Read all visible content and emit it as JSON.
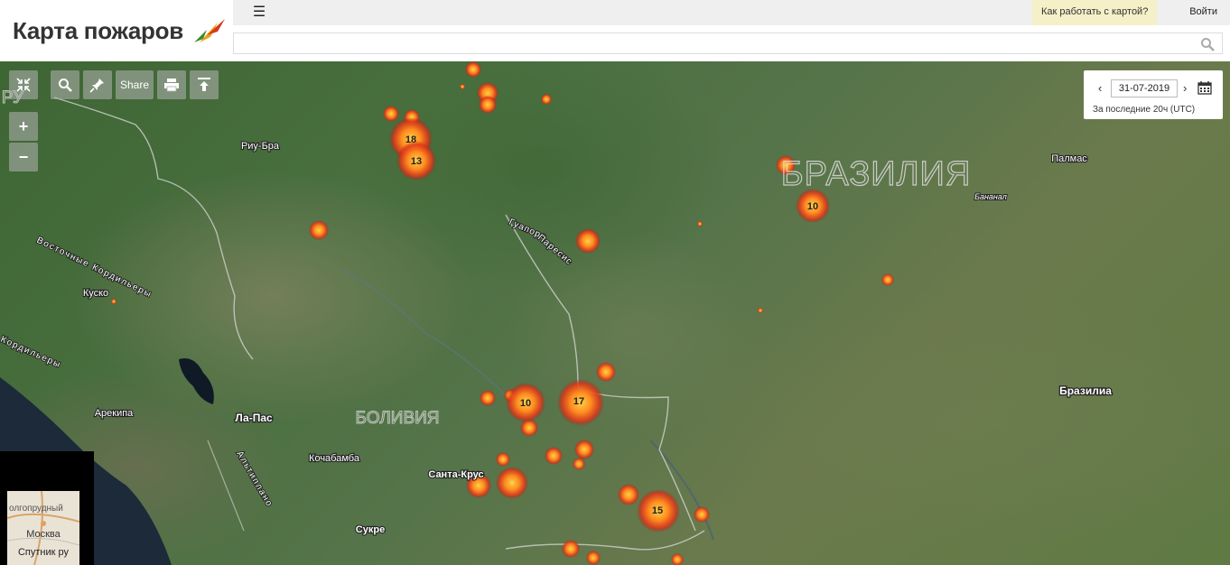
{
  "brand": {
    "title": "Карта пожаров"
  },
  "topbar": {
    "menu_icon": "☰",
    "help": "Как работать с картой?",
    "login": "Войти"
  },
  "search": {
    "value": "",
    "placeholder": ""
  },
  "controls": {
    "share_label": "Share",
    "zoom_in": "+",
    "zoom_out": "−"
  },
  "date": {
    "value": "31-07-2019",
    "period": "За последние 20ч (UTC)"
  },
  "map": {
    "places": [
      {
        "label": "Риу-Бра",
        "bold": false
      },
      {
        "label": "Палмас",
        "bold": false
      },
      {
        "label": "Бананал",
        "bold": false
      },
      {
        "label": "БРАЗИЛИЯ",
        "bold": false
      },
      {
        "label": "Куско",
        "bold": false
      },
      {
        "label": "Арекипа",
        "bold": false
      },
      {
        "label": "Ла-Пас",
        "bold": true
      },
      {
        "label": "Кочабамба",
        "bold": false
      },
      {
        "label": "Санта-Крус",
        "bold": false
      },
      {
        "label": "Сукре",
        "bold": false
      },
      {
        "label": "Бразилиа",
        "bold": true
      },
      {
        "label": "БОЛИВИЯ",
        "bold": false
      },
      {
        "label": "РУ",
        "bold": false
      },
      {
        "label": "Восточные Кордильеры",
        "bold": false
      },
      {
        "label": "Кордильеры",
        "bold": false
      },
      {
        "label": "Альтиплано",
        "bold": false
      },
      {
        "label": "Гуапоре",
        "bold": false
      },
      {
        "label": "Паресис",
        "bold": false
      }
    ],
    "clusters": [
      "18",
      "13",
      "10",
      "10",
      "17",
      "15"
    ]
  },
  "minimap": {
    "city": "Москва",
    "type": "Спутник ру",
    "top_label": "олгопрудный"
  }
}
